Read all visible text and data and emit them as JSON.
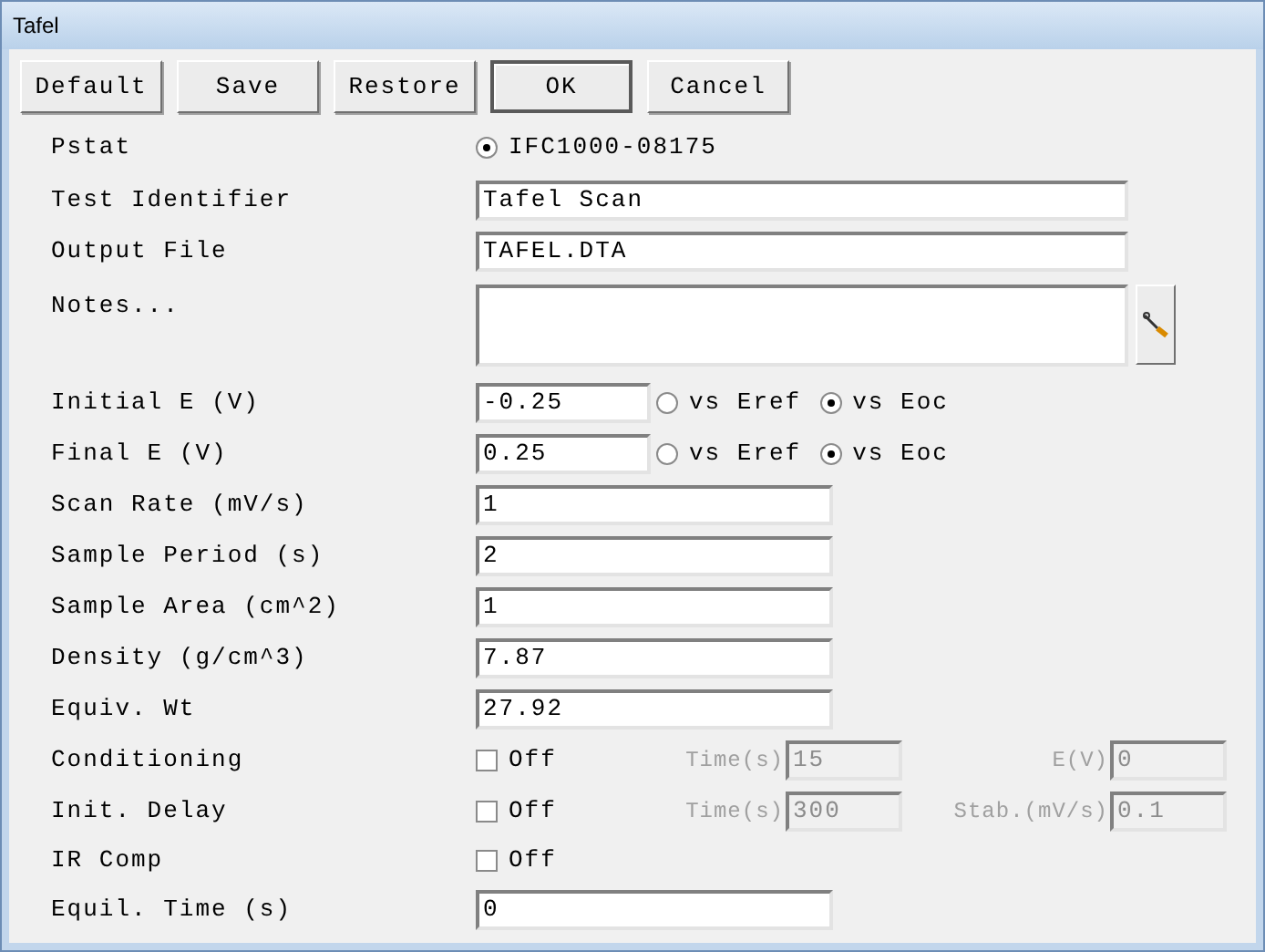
{
  "window": {
    "title": "Tafel"
  },
  "buttons": [
    {
      "label": "Default",
      "default": false
    },
    {
      "label": "Save",
      "default": false
    },
    {
      "label": "Restore",
      "default": false
    },
    {
      "label": "OK",
      "default": true
    },
    {
      "label": "Cancel",
      "default": false
    }
  ],
  "rows": [
    {
      "kind": "radio",
      "label": "Pstat",
      "options": [
        {
          "label": "IFC1000-08175",
          "selected": true
        }
      ]
    },
    {
      "kind": "wide_text",
      "label": "Test Identifier",
      "value": "Tafel Scan"
    },
    {
      "kind": "wide_text",
      "label": "Output File",
      "value": "TAFEL.DTA"
    },
    {
      "kind": "notes",
      "label": "Notes...",
      "value": ""
    },
    {
      "kind": "potential",
      "label": "Initial E (V)",
      "value": "-0.25",
      "options": [
        {
          "label": "vs Eref",
          "selected": false
        },
        {
          "label": "vs Eoc",
          "selected": true
        }
      ]
    },
    {
      "kind": "potential",
      "label": "Final E (V)",
      "value": "0.25",
      "options": [
        {
          "label": "vs Eref",
          "selected": false
        },
        {
          "label": "vs Eoc",
          "selected": true
        }
      ]
    },
    {
      "kind": "text",
      "label": "Scan Rate (mV/s)",
      "value": "1"
    },
    {
      "kind": "text",
      "label": "Sample Period (s)",
      "value": "2"
    },
    {
      "kind": "text",
      "label": "Sample Area (cm^2)",
      "value": "1"
    },
    {
      "kind": "text",
      "label": "Density (g/cm^3)",
      "value": "7.87"
    },
    {
      "kind": "text",
      "label": "Equiv. Wt",
      "value": "27.92"
    },
    {
      "kind": "check",
      "label": "Conditioning",
      "check_label": "Off",
      "checked": false,
      "fields": [
        {
          "label": "Time(s)",
          "value": "15",
          "disabled": true
        },
        {
          "label": "E(V)",
          "value": "0",
          "disabled": true
        }
      ]
    },
    {
      "kind": "check",
      "label": "Init. Delay",
      "check_label": "Off",
      "checked": false,
      "fields": [
        {
          "label": "Time(s)",
          "value": "300",
          "disabled": true
        },
        {
          "label": "Stab.(mV/s)",
          "value": "0.1",
          "disabled": true
        }
      ]
    },
    {
      "kind": "check",
      "label": "IR Comp",
      "check_label": "Off",
      "checked": false
    },
    {
      "kind": "text",
      "label": "Equil. Time (s)",
      "value": "0"
    }
  ]
}
